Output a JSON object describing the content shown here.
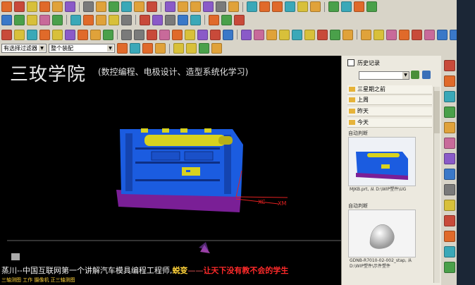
{
  "window": {
    "title_main": "三玫学院",
    "title_sub": "(数控编程、电极设计、造型系统化学习)"
  },
  "toolbar": {
    "filter_dropdown": "有选择过滤器",
    "assembly_dropdown": "整个装配",
    "row1_icons": [
      "file-icon",
      "open-icon",
      "save-icon",
      "print-icon",
      "cut-icon",
      "copy-icon",
      "paste-icon",
      "undo-icon",
      "redo-icon",
      "help-icon",
      "layer-icon",
      "view-icon",
      "fit-icon",
      "rotate-icon",
      "pan-icon",
      "zoom-icon",
      "shade-icon",
      "wire-icon",
      "section-icon",
      "measure-icon",
      "info-icon",
      "analysis-icon",
      "grid-icon",
      "target-icon",
      "camera-icon",
      "print2-icon",
      "window-icon",
      "cascade-icon"
    ],
    "row2_icons": [
      "sketch-icon",
      "point-icon",
      "line-icon",
      "arc-icon",
      "circle-icon",
      "spline-icon",
      "offset-icon",
      "trim-icon",
      "extend-icon",
      "fillet-icon",
      "chamfer-icon",
      "mirror-icon",
      "pattern-icon",
      "project-icon",
      "intersect-icon",
      "dimension-icon",
      "constraint-icon",
      "finish-icon"
    ],
    "row3_icons": [
      "extrude-icon",
      "revolve-icon",
      "sweep-icon",
      "block-icon",
      "cylinder-icon",
      "cone-icon",
      "sphere-icon",
      "hole-icon",
      "boss-icon",
      "pocket-icon",
      "pad-icon",
      "slot-icon",
      "groove-icon",
      "unite-icon",
      "subtract-icon",
      "intersect-body-icon",
      "trim-body-icon",
      "split-icon",
      "blend-icon",
      "shell-icon",
      "draft-icon",
      "thicken-icon",
      "scale-icon",
      "offset-face-icon",
      "patch-icon",
      "sew-icon",
      "extract-icon",
      "move-icon",
      "delete-icon",
      "color-icon",
      "hide-icon",
      "show-icon",
      "layer2-icon",
      "display-icon",
      "edge-icon",
      "text-icon"
    ],
    "row4_icons": [
      "snap-icon",
      "endpoint-icon",
      "midpoint-icon",
      "center-icon",
      "quadrant-icon",
      "arrow-icon",
      "point-snap-icon",
      "face-icon"
    ]
  },
  "graphics": {
    "axis_labels": [
      "XC",
      "XM"
    ],
    "bottom_text_prefix": "蒸川--中国互联网第一个讲解汽车模具编程工程师,",
    "bottom_text_highlight": "蜕变",
    "bottom_text_dash": "——",
    "bottom_text_slogan": "让天下没有教不会的学生",
    "status_text": "三轴测图 工作 摄像机 正三轴测图"
  },
  "history": {
    "title": "历史记录",
    "folders": [
      "三星期之前",
      "上周",
      "昨天",
      "今天"
    ],
    "entries": [
      {
        "label": "自动判断",
        "caption": "MJKB.prt, 从 D:\\WIP塑件\\UG"
      },
      {
        "label": "自动判断",
        "caption": "GDNB-R7010-02-002_stap, 从 D:\\WIP塑件\\示件塑件"
      }
    ]
  },
  "colors": {
    "mold_blue": "#1b5ce0",
    "mold_purple": "#7a1f96",
    "mold_yellow": "#d8d21e",
    "axis_red": "#e02020",
    "toolbar_bg": "#d8d4c8",
    "history_bg": "#ece9df"
  }
}
